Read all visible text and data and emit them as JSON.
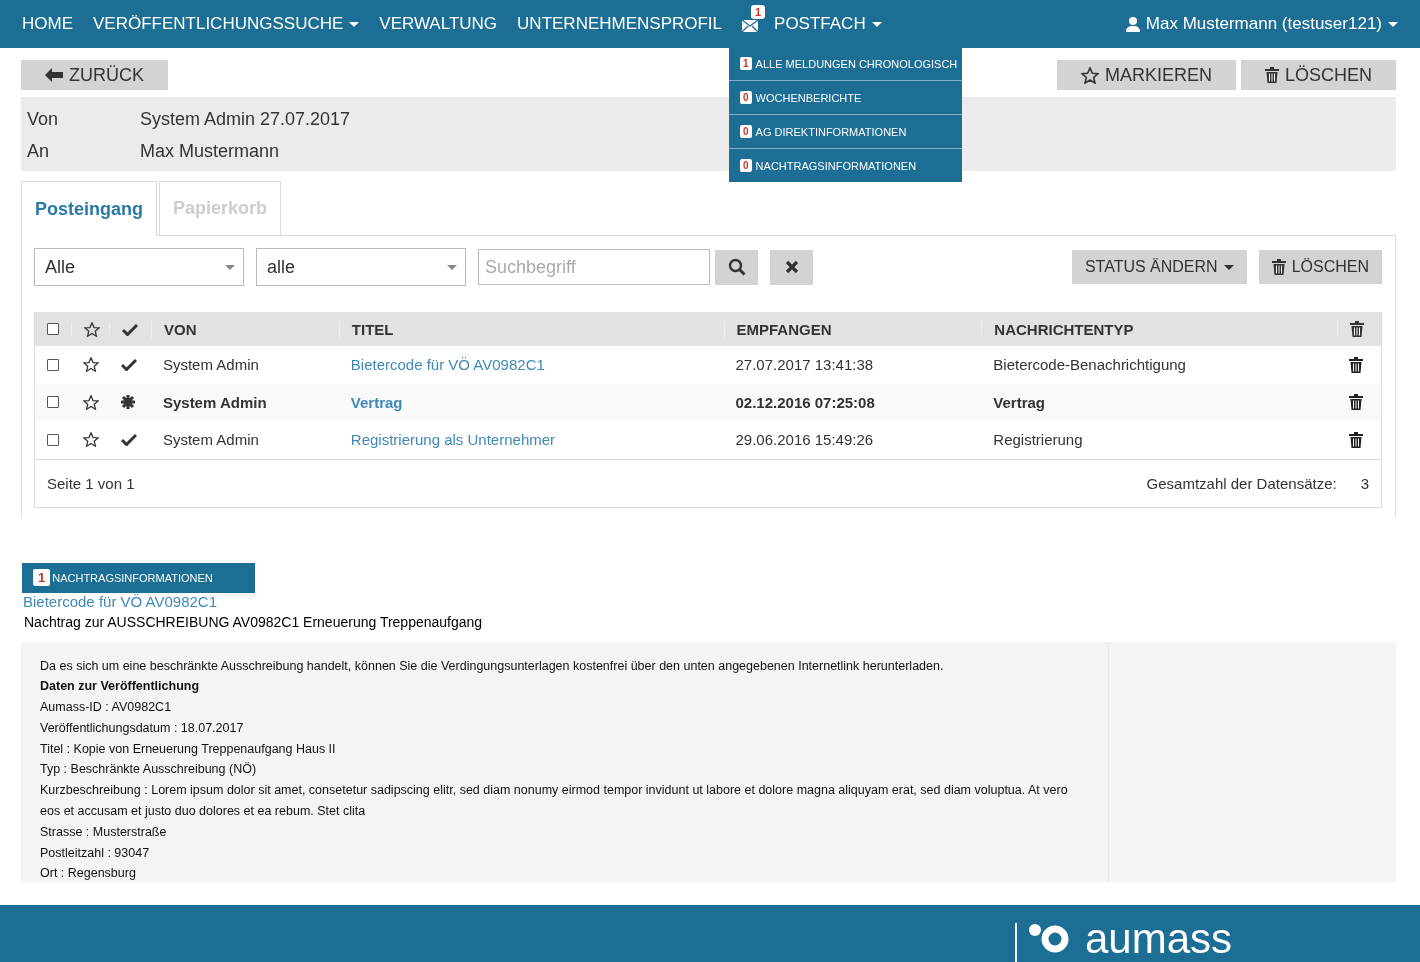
{
  "nav": {
    "items": [
      {
        "kind": "link",
        "label": "HOME",
        "caret": false
      },
      {
        "kind": "link",
        "label": "VERÖFFENTLICHUNGSSUCHE",
        "caret": true
      },
      {
        "kind": "link",
        "label": "VERWALTUNG",
        "caret": false
      },
      {
        "kind": "link",
        "label": "UNTERNEHMENSPROFIL",
        "caret": false
      },
      {
        "kind": "mail",
        "badge": "1"
      },
      {
        "kind": "menu",
        "label": "POSTFACH",
        "caret": true,
        "expanded": true,
        "menu": [
          {
            "count": "1",
            "label": "ALLE MELDUNGEN CHRONOLOGISCH"
          },
          {
            "count": "0",
            "label": "WOCHENBERICHTE"
          },
          {
            "count": "0",
            "label": "AG DIREKTINFORMATIONEN"
          },
          {
            "count": "0",
            "label": "NACHTRAGSINFORMATIONEN"
          }
        ]
      }
    ],
    "user": {
      "label": "Max Mustermann (testuser121)",
      "caret": true
    }
  },
  "toolbar": {
    "back": "ZURÜCK",
    "mark": "MARKIEREN",
    "delete": "LÖSCHEN"
  },
  "header": [
    {
      "label": "Von",
      "value": "System Admin 27.07.2017"
    },
    {
      "label": "An",
      "value": "Max Mustermann"
    }
  ],
  "tabs": [
    {
      "label": "Posteingang",
      "selected": true
    },
    {
      "label": "Papierkorb",
      "selected": false
    }
  ],
  "filters": {
    "select_1": "Alle",
    "select_2": "alle",
    "search": {
      "placeholder": "Suchbegriff"
    },
    "status": "STATUS ÄNDERN",
    "delete": "LÖSCHEN"
  },
  "table": {
    "select_all": false,
    "columns": [
      "VON",
      "TITEL",
      "EMPFANGEN",
      "NACHRICHTENTYP"
    ],
    "rows": [
      {
        "checked": false,
        "starred": false,
        "read": true,
        "von": "System Admin",
        "titel": "Bietercode für VÖ AV0982C1",
        "empfangen": "27.07.2017 13:41:38",
        "typ": "Bietercode-Benachrichtigung"
      },
      {
        "checked": false,
        "starred": false,
        "read": false,
        "von": "System Admin",
        "titel": "Vertrag",
        "empfangen": "02.12.2016 07:25:08",
        "typ": "Vertrag"
      },
      {
        "checked": false,
        "starred": false,
        "read": true,
        "von": "System Admin",
        "titel": "Registrierung als Unternehmer",
        "empfangen": "29.06.2016 15:49:26",
        "typ": "Registrierung"
      }
    ],
    "page": "Seite 1 von 1",
    "total_label": "Gesamtzahl der Datensätze:",
    "total": "3"
  },
  "detail": {
    "badge": "1",
    "category": "NACHTRAGSINFORMATIONEN",
    "link": "Bietercode für VÖ AV0982C1",
    "subject": "Nachtrag zur AUSSCHREIBUNG AV0982C1 Erneuerung Treppenaufgang",
    "body": [
      {
        "kind": "text",
        "text": "Da es sich um eine beschränkte Ausschreibung handelt, können Sie die Verdingungsunterlagen kostenfrei über den unten angegebenen Internetlink herunterladen."
      },
      {
        "kind": "heading",
        "text": "Daten zur Veröffentlichung"
      },
      {
        "kind": "text",
        "text": "Aumass-ID : AV0982C1"
      },
      {
        "kind": "text",
        "text": "Veröffentlichungsdatum : 18.07.2017"
      },
      {
        "kind": "text",
        "text": "Titel : Kopie von Erneuerung Treppenaufgang Haus II"
      },
      {
        "kind": "text",
        "text": "Typ : Beschränkte Ausschreibung (NÖ)"
      },
      {
        "kind": "text",
        "text": "Kurzbeschreibung : Lorem ipsum dolor sit amet, consetetur sadipscing elitr, sed diam nonumy eirmod tempor invidunt ut labore et dolore magna aliquyam erat, sed diam voluptua. At vero eos et accusam et justo duo dolores et ea rebum. Stet clita"
      },
      {
        "kind": "text",
        "text": "Strasse : Musterstraße"
      },
      {
        "kind": "text",
        "text": "Postleitzahl : 93047"
      },
      {
        "kind": "text",
        "text": "Ort : Regensburg"
      }
    ]
  },
  "footer": {
    "brand": "aumass"
  }
}
